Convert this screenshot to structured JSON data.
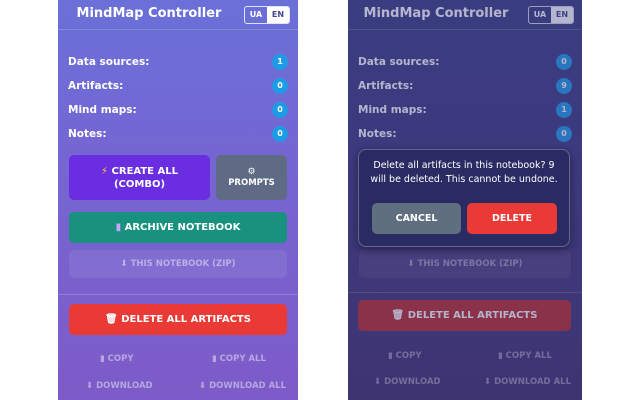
{
  "app": {
    "title": "MindMap Controller",
    "lang_options": [
      "UA",
      "EN"
    ],
    "lang_selected": "EN"
  },
  "stats": [
    {
      "label": "Data sources:",
      "value": "1"
    },
    {
      "label": "Artifacts:",
      "value": "0"
    },
    {
      "label": "Mind maps:",
      "value": "0"
    },
    {
      "label": "Notes:",
      "value": "0"
    }
  ],
  "stats_after": [
    {
      "label": "Data sources:",
      "value": "0"
    },
    {
      "label": "Artifacts:",
      "value": "9"
    },
    {
      "label": "Mind maps:",
      "value": "1"
    },
    {
      "label": "Notes:",
      "value": "0"
    }
  ],
  "actions": {
    "create_all": "CREATE ALL (COMBO)",
    "create_icon": "lightning-icon",
    "prompts": "PROMPTS",
    "prompts_icon": "gear-icon",
    "archive_notebook": "ARCHIVE NOTEBOOK",
    "archive_icon": "archive-icon",
    "this_notebook_zip": "THIS NOTEBOOK (ZIP)",
    "zip_icon": "download-arrow-icon",
    "delete_all": "DELETE ALL ARTIFACTS",
    "delete_icon": "trash-icon",
    "copy": "COPY",
    "copy_all": "COPY ALL",
    "download": "DOWNLOAD",
    "download_all": "DOWNLOAD ALL"
  },
  "dialog": {
    "message": "Delete all artifacts in this notebook? 9 will be deleted. This cannot be undone.",
    "cancel": "CANCEL",
    "confirm": "DELETE"
  },
  "colors": {
    "badge_blue": "#1e9be6",
    "create_purple": "#6a2ee0",
    "prompts_slate": "#5f6b85",
    "archive_teal": "#18917e",
    "delete_red": "#ea3a36",
    "cancel_gray": "#5f6f80"
  }
}
